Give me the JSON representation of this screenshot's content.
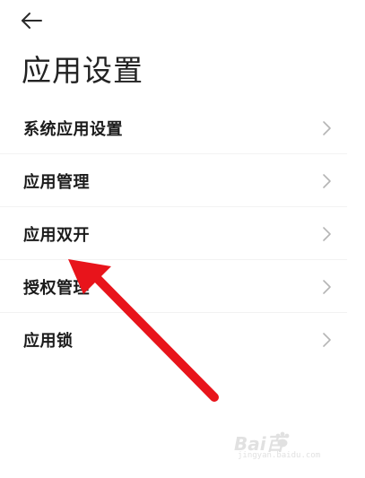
{
  "header": {
    "back_icon": "arrow-left-icon",
    "title": "应用设置"
  },
  "settings": {
    "items": [
      {
        "label": "系统应用设置",
        "icon": "chevron-right-icon"
      },
      {
        "label": "应用管理",
        "icon": "chevron-right-icon"
      },
      {
        "label": "应用双开",
        "icon": "chevron-right-icon"
      },
      {
        "label": "授权管理",
        "icon": "chevron-right-icon"
      },
      {
        "label": "应用锁",
        "icon": "chevron-right-icon"
      }
    ]
  },
  "annotation": {
    "arrow_color": "#e8141b",
    "points_to": "应用双开"
  },
  "watermark": {
    "logo": "Bai百",
    "url": "jingyan.baidu.com"
  },
  "colors": {
    "background": "#ffffff",
    "text": "#1b1b1b",
    "chevron": "#b5b5b5",
    "divider": "#f2f2f2"
  }
}
